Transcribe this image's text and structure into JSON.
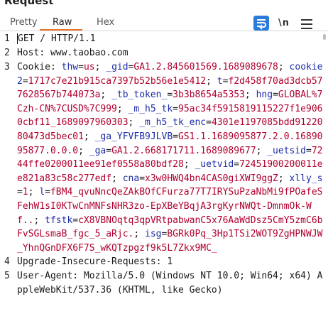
{
  "panel": {
    "title": "Request",
    "tabs": [
      "Pretty",
      "Raw",
      "Hex"
    ],
    "active_tab": "Raw",
    "newline_label": "\\n"
  },
  "request_lines": [
    {
      "n": "1",
      "text": "GET / HTTP/1.1"
    },
    {
      "n": "2",
      "header": "Host",
      "value": "www.taobao.com"
    },
    {
      "n": "3",
      "header": "Cookie",
      "cookies": [
        {
          "k": "thw",
          "v": "us"
        },
        {
          "k": "_gid",
          "v": "GA1.2.845601569.1689089678"
        },
        {
          "k": "cookie2",
          "v": "1717c7e21b915ca7397b52b56e1e5412"
        },
        {
          "k": "t",
          "v": "f2d458f70ad3dcb577628567b744073a"
        },
        {
          "k": "_tb_token_",
          "v": "3b3b8654a5353"
        },
        {
          "k": "hng",
          "v": "GLOBAL%7Czh-CN%7CUSD%7C999"
        },
        {
          "k": "_m_h5_tk",
          "v": "95ac34f5915819115227f1e9060cbf11_1689097960303"
        },
        {
          "k": "_m_h5_tk_enc",
          "v": "4301e1197085bdd9122080473d5bec01"
        },
        {
          "k": "_ga_YFVFB9JLVB",
          "v": "GS1.1.1689095877.2.0.1689095877.0.0.0"
        },
        {
          "k": "_ga",
          "v": "GA1.2.668171711.1689089677"
        },
        {
          "k": "_uetsid",
          "v": "7244ffe0200011ee91ef0558a80bdf28"
        },
        {
          "k": "_uetvid",
          "v": "72451900200011ee821a83c58c277edf"
        },
        {
          "k": "cna",
          "v": "x3w0HWQ4bn4CAS0giXWI9ggZ"
        },
        {
          "k": "xlly_s",
          "v": "1"
        },
        {
          "k": "l",
          "v": "fBM4_qvuNncQeZAkBOfCFurza77T7IRYSuPzaNbMi9fPOafeSFehW1sI0KTwCnMNFsNHR3zo-EpXBeYBqjA3rgKyrNWQt-DmnmOk-Wf.."
        },
        {
          "k": "tfstk",
          "v": "cX8VBNOqtq3qpVRtpabwanC5x76AaWdDsz5CmY5zmC6bFvSGLsmaB_fgc_5_aRjc."
        },
        {
          "k": "isg",
          "v": "BGRk0Pq_3Hp1TSi2WOT9ZgHPNWJW_YhnQGnDFX6F7S_wKQTzpgzf9k5L7Zkx9MC_"
        }
      ]
    },
    {
      "n": "4",
      "header": "Upgrade-Insecure-Requests",
      "value": "1"
    },
    {
      "n": "5",
      "header": "User-Agent",
      "value": "Mozilla/5.0 (Windows NT 10.0; Win64; x64) AppleWebKit/537.36 (KHTML, like Gecko)"
    }
  ]
}
